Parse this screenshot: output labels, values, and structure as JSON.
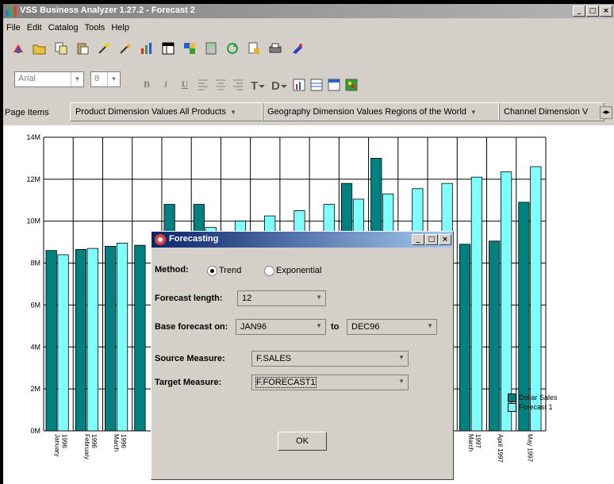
{
  "window": {
    "title": "VSS Business Analyzer 1.27.2 - Forecast 2",
    "controls": [
      "_",
      "□",
      "×"
    ]
  },
  "menu": [
    "File",
    "Edit",
    "Catalog",
    "Tools",
    "Help"
  ],
  "toolbar": {
    "icons": [
      "new-icon",
      "open-icon",
      "copy-icon",
      "paste-icon",
      "tool-icon",
      "wand-icon",
      "chart-icon",
      "table-icon",
      "pivot-icon",
      "calc-icon",
      "refresh-icon",
      "export-icon",
      "print-icon",
      "help-icon"
    ],
    "font_value": "Arial",
    "size_value": "8",
    "format": [
      "B",
      "i",
      "U"
    ]
  },
  "page_items": {
    "label": "Page Items",
    "items": [
      {
        "text": "Product Dimension Values  All Products"
      },
      {
        "text": "Geography Dimension Values  Regions of the World"
      },
      {
        "text": "Channel Dimension V"
      }
    ]
  },
  "chart_data": {
    "type": "bar",
    "y_ticks": [
      "0M",
      "2M",
      "4M",
      "6M",
      "8M",
      "10M",
      "12M",
      "14M"
    ],
    "ylim": [
      0,
      14
    ],
    "categories": [
      "January 1996",
      "February 1996",
      "March 1996",
      "",
      "",
      "",
      "",
      "",
      "",
      "",
      "",
      "",
      "",
      "",
      "March 1997",
      "April 1997",
      "May 1997"
    ],
    "visible_x_labels": [
      [
        "January",
        "1996"
      ],
      [
        "February",
        "1996"
      ],
      [
        "March",
        "1996"
      ],
      [
        "March",
        "1997"
      ],
      [
        "April 1997"
      ],
      [
        "May 1997"
      ]
    ],
    "series": [
      {
        "name": "Dollar Sales",
        "color": "#008080",
        "values": [
          8.6,
          8.65,
          8.8,
          8.85,
          10.8,
          10.8,
          null,
          null,
          null,
          null,
          11.8,
          13.0,
          null,
          null,
          8.9,
          9.05,
          10.9
        ]
      },
      {
        "name": "Forecast 1",
        "color": "#7fffff",
        "values": [
          8.4,
          8.7,
          8.95,
          null,
          null,
          9.7,
          10.0,
          10.25,
          10.5,
          10.8,
          11.05,
          11.3,
          11.55,
          11.8,
          12.1,
          12.35,
          12.6
        ]
      }
    ],
    "grid": true,
    "legend": "right"
  },
  "dialog": {
    "title": "Forecasting",
    "method_label": "Method:",
    "method_options": [
      "Trend",
      "Exponential"
    ],
    "method_selected": "Trend",
    "forecast_length_label": "Forecast length:",
    "forecast_length": "12",
    "base_label": "Base forecast on:",
    "base_from": "JAN96",
    "to_label": "to",
    "base_to": "DEC96",
    "source_label": "Source Measure:",
    "source_value": "F.SALES",
    "target_label": "Target Measure:",
    "target_value": "F.FORECAST1",
    "ok_label": "OK"
  }
}
